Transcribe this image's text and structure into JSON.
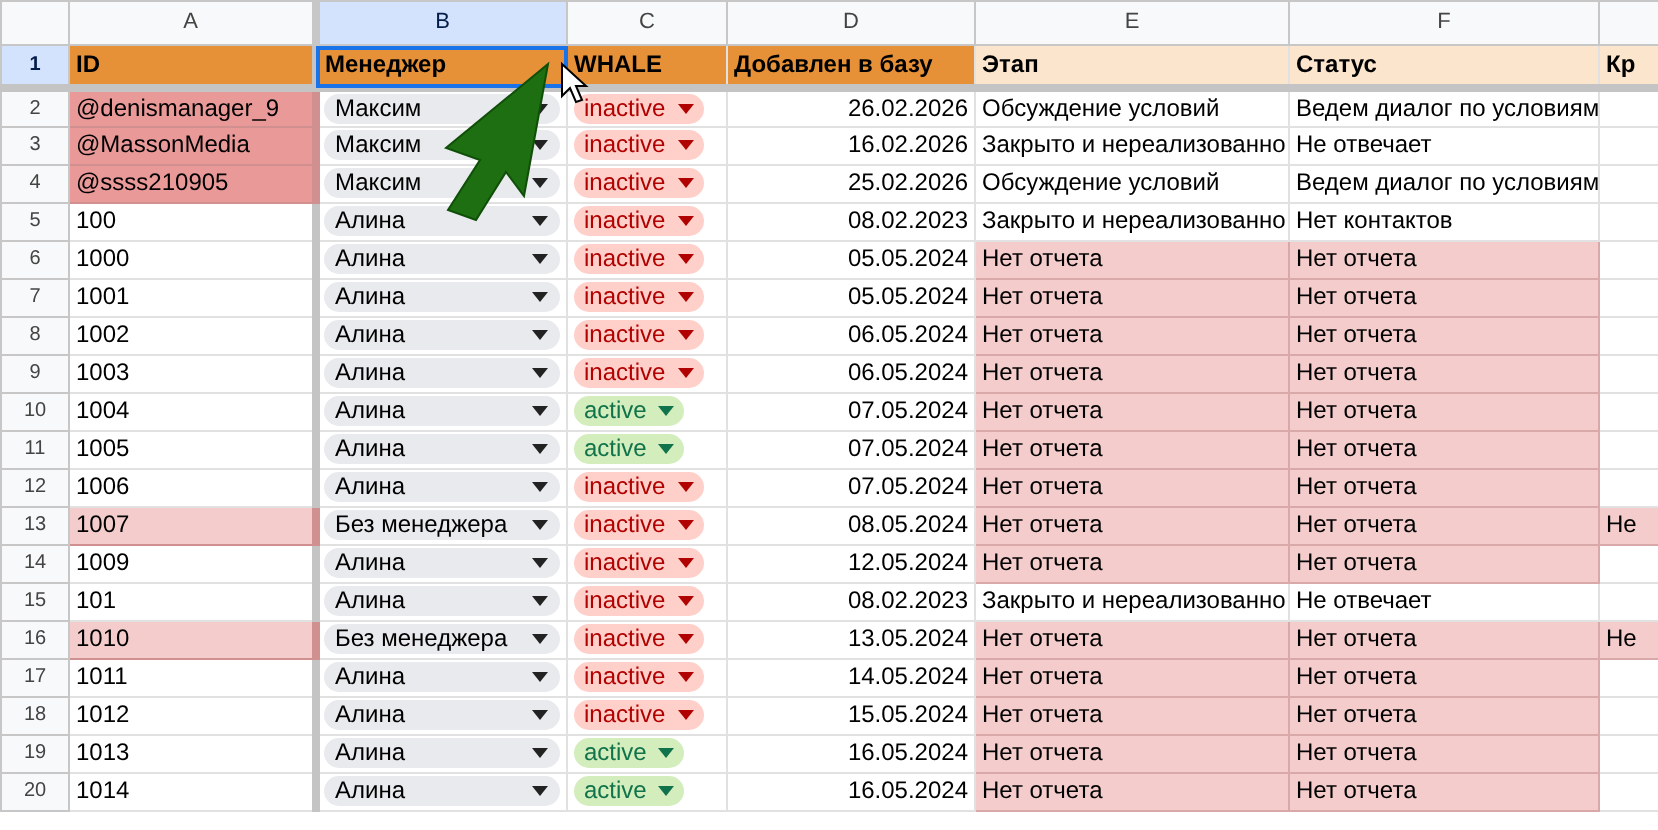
{
  "column_letters": [
    {
      "label": "A",
      "selected": false
    },
    {
      "label": "B",
      "selected": true
    },
    {
      "label": "C",
      "selected": false
    },
    {
      "label": "D",
      "selected": false
    },
    {
      "label": "E",
      "selected": false
    },
    {
      "label": "F",
      "selected": false
    }
  ],
  "header_row": {
    "number": "1",
    "cells": [
      {
        "text": "ID",
        "color": "#e69138"
      },
      {
        "text": "Менеджер",
        "color": "#e69138",
        "selected": true
      },
      {
        "text": "WHALE",
        "color": "#e69138"
      },
      {
        "text": "Добавлен в базу",
        "color": "#e69138"
      },
      {
        "text": "Этап",
        "color": "#fce5cd"
      },
      {
        "text": "Статус",
        "color": "#fce5cd"
      },
      {
        "text": "Кр",
        "color": "#fce5cd"
      }
    ]
  },
  "rows": [
    {
      "number": "2",
      "id": {
        "text": "@denismanager_9",
        "color": "#ea9999"
      },
      "manager": "Максим",
      "whale": "inactive",
      "whale_active": false,
      "date": "26.02.2026",
      "stage": "Обсуждение условий",
      "status": "Ведем диалог по условиям",
      "flagged": false
    },
    {
      "number": "3",
      "id": {
        "text": "@MassonMedia",
        "color": "#ea9999"
      },
      "manager": "Максим",
      "whale": "inactive",
      "whale_active": false,
      "date": "16.02.2026",
      "stage": "Закрыто и нереализованно",
      "status": "Не отвечает",
      "flagged": false
    },
    {
      "number": "4",
      "id": {
        "text": "@ssss210905",
        "color": "#ea9999"
      },
      "manager": "Максим",
      "whale": "inactive",
      "whale_active": false,
      "date": "25.02.2026",
      "stage": "Обсуждение условий",
      "status": "Ведем диалог по условиям",
      "flagged": false
    },
    {
      "number": "5",
      "id": "100",
      "manager": "Алина",
      "whale": "inactive",
      "whale_active": false,
      "date": "08.02.2023",
      "stage": "Закрыто и нереализованно",
      "status": "Нет контактов",
      "flagged": false
    },
    {
      "number": "6",
      "id": "1000",
      "manager": "Алина",
      "whale": "inactive",
      "whale_active": false,
      "date": "05.05.2024",
      "stage": "Нет отчета",
      "status": "Нет отчета",
      "flagged": true
    },
    {
      "number": "7",
      "id": "1001",
      "manager": "Алина",
      "whale": "inactive",
      "whale_active": false,
      "date": "05.05.2024",
      "stage": "Нет отчета",
      "status": "Нет отчета",
      "flagged": true
    },
    {
      "number": "8",
      "id": "1002",
      "manager": "Алина",
      "whale": "inactive",
      "whale_active": false,
      "date": "06.05.2024",
      "stage": "Нет отчета",
      "status": "Нет отчета",
      "flagged": true
    },
    {
      "number": "9",
      "id": "1003",
      "manager": "Алина",
      "whale": "inactive",
      "whale_active": false,
      "date": "06.05.2024",
      "stage": "Нет отчета",
      "status": "Нет отчета",
      "flagged": true
    },
    {
      "number": "10",
      "id": "1004",
      "manager": "Алина",
      "whale": "active",
      "whale_active": true,
      "date": "07.05.2024",
      "stage": "Нет отчета",
      "status": "Нет отчета",
      "flagged": true
    },
    {
      "number": "11",
      "id": "1005",
      "manager": "Алина",
      "whale": "active",
      "whale_active": true,
      "date": "07.05.2024",
      "stage": "Нет отчета",
      "status": "Нет отчета",
      "flagged": true
    },
    {
      "number": "12",
      "id": "1006",
      "manager": "Алина",
      "whale": "inactive",
      "whale_active": false,
      "date": "07.05.2024",
      "stage": "Нет отчета",
      "status": "Нет отчета",
      "flagged": true
    },
    {
      "number": "13",
      "id": {
        "text": "1007",
        "color": "#f4cccc"
      },
      "manager": "Без менеджера",
      "whale": "inactive",
      "whale_active": false,
      "date": "08.05.2024",
      "stage": "Нет отчета",
      "status": "Нет отчета",
      "flagged": true,
      "column_7": "Не"
    },
    {
      "number": "14",
      "id": "1009",
      "manager": "Алина",
      "whale": "inactive",
      "whale_active": false,
      "date": "12.05.2024",
      "stage": "Нет отчета",
      "status": "Нет отчета",
      "flagged": true
    },
    {
      "number": "15",
      "id": "101",
      "manager": "Алина",
      "whale": "inactive",
      "whale_active": false,
      "date": "08.02.2023",
      "stage": "Закрыто и нереализованно",
      "status": "Не отвечает",
      "flagged": false
    },
    {
      "number": "16",
      "id": {
        "text": "1010",
        "color": "#f4cccc"
      },
      "manager": "Без менеджера",
      "whale": "inactive",
      "whale_active": false,
      "date": "13.05.2024",
      "stage": "Нет отчета",
      "status": "Нет отчета",
      "flagged": true,
      "column_7": "Не"
    },
    {
      "number": "17",
      "id": "1011",
      "manager": "Алина",
      "whale": "inactive",
      "whale_active": false,
      "date": "14.05.2024",
      "stage": "Нет отчета",
      "status": "Нет отчета",
      "flagged": true
    },
    {
      "number": "18",
      "id": "1012",
      "manager": "Алина",
      "whale": "inactive",
      "whale_active": false,
      "date": "15.05.2024",
      "stage": "Нет отчета",
      "status": "Нет отчета",
      "flagged": true
    },
    {
      "number": "19",
      "id": "1013",
      "manager": "Алина",
      "whale": "active",
      "whale_active": true,
      "date": "16.05.2024",
      "stage": "Нет отчета",
      "status": "Нет отчета",
      "flagged": true
    },
    {
      "number": "20",
      "id": "1014",
      "manager": "Алина",
      "whale": "active",
      "whale_active": true,
      "date": "16.05.2024",
      "stage": "Нет отчета",
      "status": "Нет отчета",
      "flagged": true
    }
  ]
}
